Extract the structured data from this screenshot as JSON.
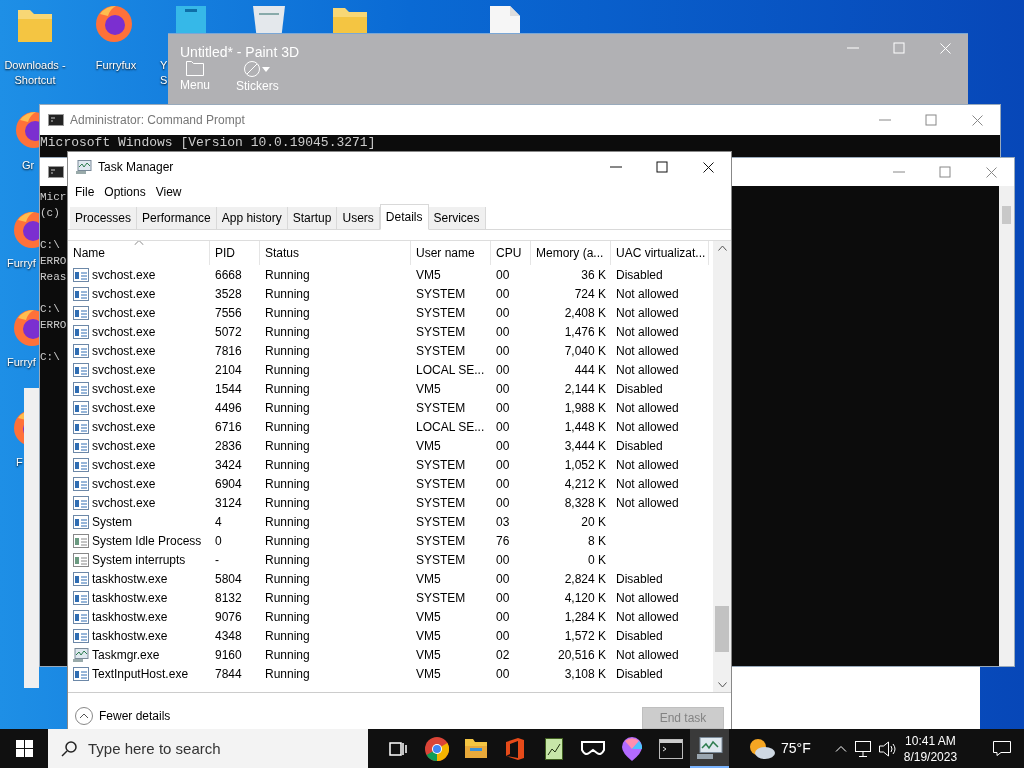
{
  "desktop": {
    "icons": [
      {
        "label": "Downloads - Shortcut",
        "kind": "folder"
      },
      {
        "label": "Furryfux",
        "kind": "browser"
      },
      {
        "label": "Y\nS",
        "kind": "app"
      },
      {
        "kind": "bin"
      },
      {
        "kind": "folder"
      },
      {
        "kind": "file"
      },
      {
        "label": "Gr",
        "kind": "browser"
      },
      {
        "label": "Furryf",
        "kind": "browser"
      },
      {
        "label": "Furryf",
        "kind": "browser"
      },
      {
        "label": "F",
        "kind": "browser"
      }
    ]
  },
  "paint": {
    "title": "Untitled* - Paint 3D",
    "tools": [
      {
        "label": "Menu",
        "kind": "folder"
      },
      {
        "label": "Stickers",
        "kind": "sticker"
      }
    ]
  },
  "consoles": [
    {
      "title": "Administrator: Command Prompt",
      "lines": [
        {
          "text": "Microsoft Windows [Version 10.0.19045.3271]",
          "gap_before": false
        }
      ]
    },
    {
      "lines": [
        {
          "text": "Micr",
          "gap_before": false
        },
        {
          "text": "(c)",
          "gap_before": false
        },
        {
          "text": "C:\\",
          "gap_before": true
        },
        {
          "text": "ERRO",
          "gap_before": false
        },
        {
          "text": "Reas",
          "gap_before": false
        },
        {
          "text": "C:\\",
          "gap_before": true
        },
        {
          "text": "ERRO",
          "gap_before": false
        },
        {
          "text": "C:\\",
          "gap_before": true
        }
      ]
    }
  ],
  "task_manager": {
    "title": "Task Manager",
    "menu": [
      "File",
      "Options",
      "View"
    ],
    "tabs": [
      {
        "label": "Processes",
        "selected": false
      },
      {
        "label": "Performance",
        "selected": false
      },
      {
        "label": "App history",
        "selected": false
      },
      {
        "label": "Startup",
        "selected": false
      },
      {
        "label": "Users",
        "selected": false
      },
      {
        "label": "Details",
        "selected": true
      },
      {
        "label": "Services",
        "selected": false
      }
    ],
    "columns": [
      {
        "label": "Name",
        "sorted": true
      },
      {
        "label": "PID",
        "sorted": false
      },
      {
        "label": "Status",
        "sorted": false
      },
      {
        "label": "User name",
        "sorted": false
      },
      {
        "label": "CPU",
        "sorted": false
      },
      {
        "label": "Memory (a...",
        "sorted": false
      },
      {
        "label": "UAC virtualizat...",
        "sorted": false
      }
    ],
    "rows": [
      {
        "kind": "service",
        "name": "svchost.exe",
        "pid": "6668",
        "status": "Running",
        "user": "VM5",
        "cpu": "00",
        "memory": "36 K",
        "uac": "Disabled"
      },
      {
        "kind": "service",
        "name": "svchost.exe",
        "pid": "3528",
        "status": "Running",
        "user": "SYSTEM",
        "cpu": "00",
        "memory": "724 K",
        "uac": "Not allowed"
      },
      {
        "kind": "service",
        "name": "svchost.exe",
        "pid": "7556",
        "status": "Running",
        "user": "SYSTEM",
        "cpu": "00",
        "memory": "2,408 K",
        "uac": "Not allowed"
      },
      {
        "kind": "service",
        "name": "svchost.exe",
        "pid": "5072",
        "status": "Running",
        "user": "SYSTEM",
        "cpu": "00",
        "memory": "1,476 K",
        "uac": "Not allowed"
      },
      {
        "kind": "service",
        "name": "svchost.exe",
        "pid": "7816",
        "status": "Running",
        "user": "SYSTEM",
        "cpu": "00",
        "memory": "7,040 K",
        "uac": "Not allowed"
      },
      {
        "kind": "service",
        "name": "svchost.exe",
        "pid": "2104",
        "status": "Running",
        "user": "LOCAL SE...",
        "cpu": "00",
        "memory": "444 K",
        "uac": "Not allowed"
      },
      {
        "kind": "service",
        "name": "svchost.exe",
        "pid": "1544",
        "status": "Running",
        "user": "VM5",
        "cpu": "00",
        "memory": "2,144 K",
        "uac": "Disabled"
      },
      {
        "kind": "service",
        "name": "svchost.exe",
        "pid": "4496",
        "status": "Running",
        "user": "SYSTEM",
        "cpu": "00",
        "memory": "1,988 K",
        "uac": "Not allowed"
      },
      {
        "kind": "service",
        "name": "svchost.exe",
        "pid": "6716",
        "status": "Running",
        "user": "LOCAL SE...",
        "cpu": "00",
        "memory": "1,448 K",
        "uac": "Not allowed"
      },
      {
        "kind": "service",
        "name": "svchost.exe",
        "pid": "2836",
        "status": "Running",
        "user": "VM5",
        "cpu": "00",
        "memory": "3,444 K",
        "uac": "Disabled"
      },
      {
        "kind": "service",
        "name": "svchost.exe",
        "pid": "3424",
        "status": "Running",
        "user": "SYSTEM",
        "cpu": "00",
        "memory": "1,052 K",
        "uac": "Not allowed"
      },
      {
        "kind": "service",
        "name": "svchost.exe",
        "pid": "6904",
        "status": "Running",
        "user": "SYSTEM",
        "cpu": "00",
        "memory": "4,212 K",
        "uac": "Not allowed"
      },
      {
        "kind": "service",
        "name": "svchost.exe",
        "pid": "3124",
        "status": "Running",
        "user": "SYSTEM",
        "cpu": "00",
        "memory": "8,328 K",
        "uac": "Not allowed"
      },
      {
        "kind": "service",
        "name": "System",
        "pid": "4",
        "status": "Running",
        "user": "SYSTEM",
        "cpu": "03",
        "memory": "20 K"
      },
      {
        "kind": "system",
        "name": "System Idle Process",
        "pid": "0",
        "status": "Running",
        "user": "SYSTEM",
        "cpu": "76",
        "memory": "8 K"
      },
      {
        "kind": "system",
        "name": "System interrupts",
        "pid": "-",
        "status": "Running",
        "user": "SYSTEM",
        "cpu": "00",
        "memory": "0 K"
      },
      {
        "kind": "service",
        "name": "taskhostw.exe",
        "pid": "5804",
        "status": "Running",
        "user": "VM5",
        "cpu": "00",
        "memory": "2,824 K",
        "uac": "Disabled"
      },
      {
        "kind": "service",
        "name": "taskhostw.exe",
        "pid": "8132",
        "status": "Running",
        "user": "SYSTEM",
        "cpu": "00",
        "memory": "4,120 K",
        "uac": "Not allowed"
      },
      {
        "kind": "service",
        "name": "taskhostw.exe",
        "pid": "9076",
        "status": "Running",
        "user": "VM5",
        "cpu": "00",
        "memory": "1,284 K",
        "uac": "Not allowed"
      },
      {
        "kind": "service",
        "name": "taskhostw.exe",
        "pid": "4348",
        "status": "Running",
        "user": "VM5",
        "cpu": "00",
        "memory": "1,572 K",
        "uac": "Disabled"
      },
      {
        "kind": "monitor",
        "name": "Taskmgr.exe",
        "pid": "9160",
        "status": "Running",
        "user": "VM5",
        "cpu": "02",
        "memory": "20,516 K",
        "uac": "Not allowed"
      },
      {
        "kind": "service",
        "name": "TextInputHost.exe",
        "pid": "7844",
        "status": "Running",
        "user": "VM5",
        "cpu": "00",
        "memory": "3,108 K",
        "uac": "Disabled"
      }
    ],
    "fewer_details": "Fewer details",
    "end_task": {
      "label": "End task",
      "disabled": true
    }
  },
  "taskbar": {
    "search_placeholder": "Type here to search",
    "apps": [
      {
        "kind": "taskview",
        "active": false
      },
      {
        "kind": "chrome",
        "active": false
      },
      {
        "kind": "explorer",
        "active": false
      },
      {
        "kind": "office",
        "active": false
      },
      {
        "kind": "notepad",
        "active": false
      },
      {
        "kind": "vr",
        "active": false
      },
      {
        "kind": "paint",
        "active": false
      },
      {
        "kind": "terminal",
        "active": false
      },
      {
        "kind": "monitor",
        "active": true
      }
    ],
    "weather": "75°F",
    "time": "10:41 AM",
    "date": "8/19/2023"
  }
}
